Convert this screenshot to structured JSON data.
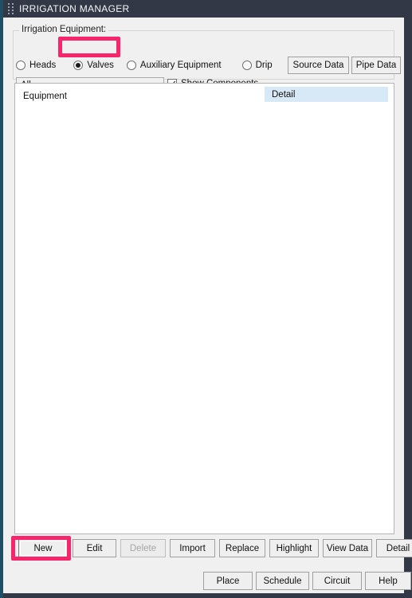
{
  "window": {
    "title": "IRRIGATION MANAGER",
    "grip_icon": "drag-grip-icon",
    "accent_color": "#1f4e66",
    "titlebar_color": "#323846"
  },
  "group": {
    "legend": "Irrigation Equipment:"
  },
  "equipment_type": {
    "selected": "Valves",
    "options": [
      {
        "label": "Heads",
        "checked": false
      },
      {
        "label": "Valves",
        "checked": true
      },
      {
        "label": "Auxiliary Equipment",
        "checked": false
      },
      {
        "label": "Drip",
        "checked": false
      }
    ]
  },
  "filter": {
    "value": "All",
    "caret_icon": "chevron-down-icon",
    "options": [
      "All"
    ]
  },
  "show_components": {
    "label": "Show Components",
    "checked": true
  },
  "data_buttons": {
    "source_data": "Source Data",
    "pipe_data": "Pipe Data"
  },
  "list": {
    "columns": [
      {
        "label": "Equipment",
        "highlighted": false
      },
      {
        "label": "Detail",
        "highlighted": true
      }
    ],
    "rows": [],
    "highlight_color": "#d7e8f7"
  },
  "actions": [
    {
      "label": "New",
      "enabled": true,
      "focused": true
    },
    {
      "label": "Edit",
      "enabled": true,
      "focused": false
    },
    {
      "label": "Delete",
      "enabled": false,
      "focused": false
    },
    {
      "label": "Import",
      "enabled": true,
      "focused": false
    },
    {
      "label": "Replace",
      "enabled": true,
      "focused": false
    },
    {
      "label": "Highlight",
      "enabled": true,
      "focused": false
    },
    {
      "label": "View Data",
      "enabled": true,
      "focused": false
    },
    {
      "label": "Detail",
      "enabled": true,
      "focused": false
    }
  ],
  "footer": [
    {
      "label": "Place"
    },
    {
      "label": "Schedule"
    },
    {
      "label": "Circuit"
    },
    {
      "label": "Help"
    }
  ],
  "annotations": {
    "color": "#f8246c",
    "targets": [
      "Valves",
      "New"
    ]
  }
}
